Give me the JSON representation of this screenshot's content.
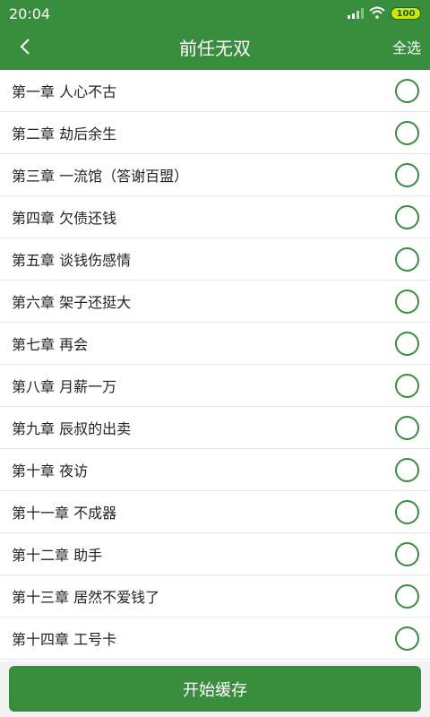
{
  "status_bar": {
    "time": "20:04",
    "battery": "100",
    "signal_icon": "signal-icon",
    "wifi_icon": "wifi-icon"
  },
  "header": {
    "title": "前任无双",
    "select_all": "全选",
    "back_icon": "back-chevron-icon"
  },
  "chapters": [
    "第一章 人心不古",
    "第二章 劫后余生",
    "第三章 一流馆（答谢百盟）",
    "第四章 欠债还钱",
    "第五章 谈钱伤感情",
    "第六章 架子还挺大",
    "第七章 再会",
    "第八章 月薪一万",
    "第九章 辰叔的出卖",
    "第十章 夜访",
    "第十一章 不成器",
    "第十二章 助手",
    "第十三章 居然不爱钱了",
    "第十四章 工号卡"
  ],
  "footer": {
    "start_button": "开始缓存"
  },
  "colors": {
    "primary": "#388e3c",
    "background": "#f2f2f2",
    "battery": "#cfe600"
  }
}
